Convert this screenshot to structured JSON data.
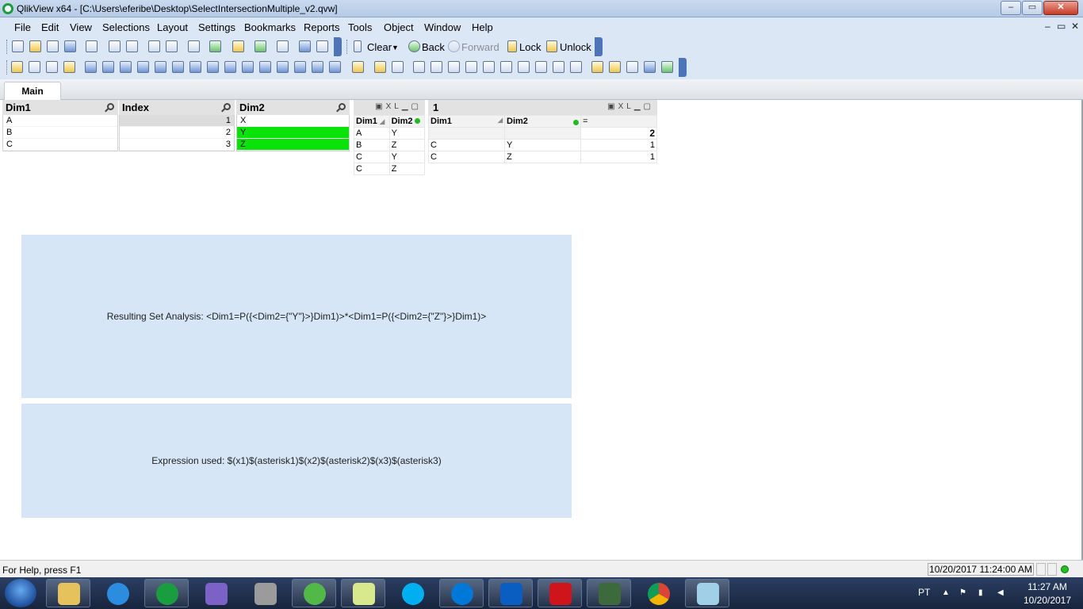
{
  "window": {
    "title": "QlikView x64 - [C:\\Users\\eferibe\\Desktop\\SelectIntersectionMultiple_v2.qvw]",
    "buttons": {
      "minimize": "–",
      "maximize": "▭",
      "close": "✕"
    }
  },
  "menu": {
    "items": [
      "File",
      "Edit",
      "View",
      "Selections",
      "Layout",
      "Settings",
      "Bookmarks",
      "Reports",
      "Tools",
      "Object",
      "Window",
      "Help"
    ],
    "mdi_controls": [
      "–",
      "▭",
      "✕"
    ]
  },
  "toolbar": {
    "clear": "Clear",
    "back": "Back",
    "forward": "Forward",
    "lock": "Lock",
    "unlock": "Unlock"
  },
  "tabs": [
    {
      "label": "Main",
      "active": true
    }
  ],
  "listboxes": {
    "dim1": {
      "caption": "Dim1",
      "rows": [
        "A",
        "B",
        "C"
      ]
    },
    "index": {
      "caption": "Index",
      "rows": [
        "1",
        "2",
        "3"
      ]
    },
    "dim2": {
      "caption": "Dim2",
      "rows": [
        "X",
        "Y",
        "Z"
      ],
      "selected": [
        "Y",
        "Z"
      ],
      "selected_color": "#09e309"
    }
  },
  "table_small": {
    "caption_icons": "XL",
    "headers": [
      "Dim1",
      "Dim2"
    ],
    "rows": [
      [
        "A",
        "Y"
      ],
      [
        "B",
        "Z"
      ],
      [
        "C",
        "Y"
      ],
      [
        "C",
        "Z"
      ]
    ]
  },
  "chart1": {
    "caption": "1",
    "caption_icons": "XL",
    "headers": [
      "Dim1",
      "Dim2",
      "="
    ],
    "total": "2",
    "rows": [
      [
        "C",
        "Y",
        "1"
      ],
      [
        "C",
        "Z",
        "1"
      ]
    ]
  },
  "textboxes": {
    "result": "Resulting Set Analysis: <Dim1=P({<Dim2={\"Y\"}>}Dim1)>*<Dim1=P({<Dim2={\"Z\"}>}Dim1)>",
    "expression": "Expression used: $(x1)$(asterisk1)$(x2)$(asterisk2)$(x3)$(asterisk3)"
  },
  "status": {
    "help": "For Help, press F1",
    "timestamp": "10/20/2017 11:24:00 AM"
  },
  "taskbar": {
    "apps": [
      "file-explorer",
      "internet-explorer",
      "qlikview",
      "visual-studio",
      "tools",
      "qlik-sense",
      "folder",
      "skype",
      "skype-business",
      "outlook",
      "acrobat",
      "task-manager",
      "chrome",
      "remote-desktop"
    ],
    "language": "PT",
    "time": "11:27 AM",
    "date": "10/20/2017"
  }
}
